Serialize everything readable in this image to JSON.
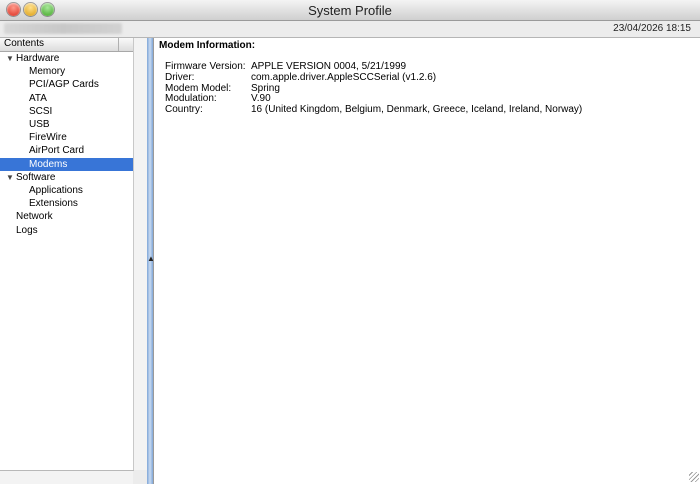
{
  "window": {
    "title": "System Profile"
  },
  "toolbar": {
    "datetime": "23/04/2026 18:15"
  },
  "sidebar": {
    "header": "Contents",
    "items": [
      {
        "label": "Hardware",
        "level": 0,
        "expanded": true
      },
      {
        "label": "Memory",
        "level": 1
      },
      {
        "label": "PCI/AGP Cards",
        "level": 1
      },
      {
        "label": "ATA",
        "level": 1
      },
      {
        "label": "SCSI",
        "level": 1
      },
      {
        "label": "USB",
        "level": 1
      },
      {
        "label": "FireWire",
        "level": 1
      },
      {
        "label": "AirPort Card",
        "level": 1
      },
      {
        "label": "Modems",
        "level": 1,
        "selected": true
      },
      {
        "label": "Software",
        "level": 0,
        "expanded": true
      },
      {
        "label": "Applications",
        "level": 1
      },
      {
        "label": "Extensions",
        "level": 1
      },
      {
        "label": "Network",
        "level": 0
      },
      {
        "label": "Logs",
        "level": 0
      }
    ]
  },
  "main": {
    "title": "Modem Information:",
    "fields": [
      {
        "key": "Firmware Version:",
        "value": "APPLE VERSION 0004, 5/21/1999"
      },
      {
        "key": "Driver:",
        "value": "com.apple.driver.AppleSCCSerial (v1.2.6)"
      },
      {
        "key": "Modem Model:",
        "value": "Spring"
      },
      {
        "key": "Modulation:",
        "value": "V.90"
      },
      {
        "key": "Country:",
        "value": "16 (United Kingdom, Belgium, Denmark, Greece, Iceland, Ireland, Norway)"
      }
    ]
  },
  "colors": {
    "selection": "#3875d7",
    "splitter": "#7fa6d8"
  }
}
